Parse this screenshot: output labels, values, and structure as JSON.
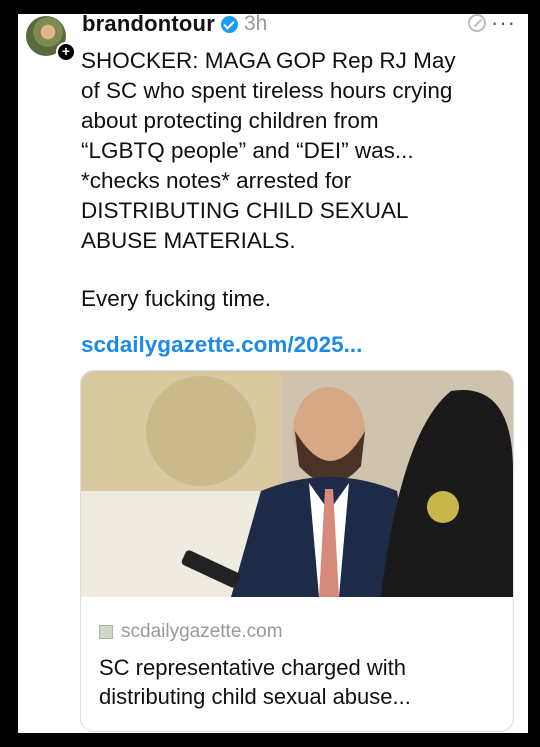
{
  "post": {
    "username": "brandontour",
    "timestamp": "3h",
    "text": "SHOCKER: MAGA GOP Rep RJ May\nof SC who spent tireless hours crying\nabout protecting children from\n“LGBTQ people” and “DEI” was...\n*checks notes* arrested for\nDISTRIBUTING CHILD SEXUAL\nABUSE MATERIALS.",
    "text2": "Every fucking time.",
    "link": "scdailygazette.com/2025..."
  },
  "card": {
    "domain": "scdailygazette.com",
    "title": "SC representative charged with\ndistributing child sexual abuse..."
  },
  "icons": {
    "avatar": "avatar-image",
    "follow": "plus-icon",
    "verified": "verified-badge-icon",
    "more": "more-icon",
    "domain": "link-favicon-icon"
  },
  "colors": {
    "link": "#1d8ae8",
    "verified": "#1d9bf0",
    "muted": "#999999"
  }
}
